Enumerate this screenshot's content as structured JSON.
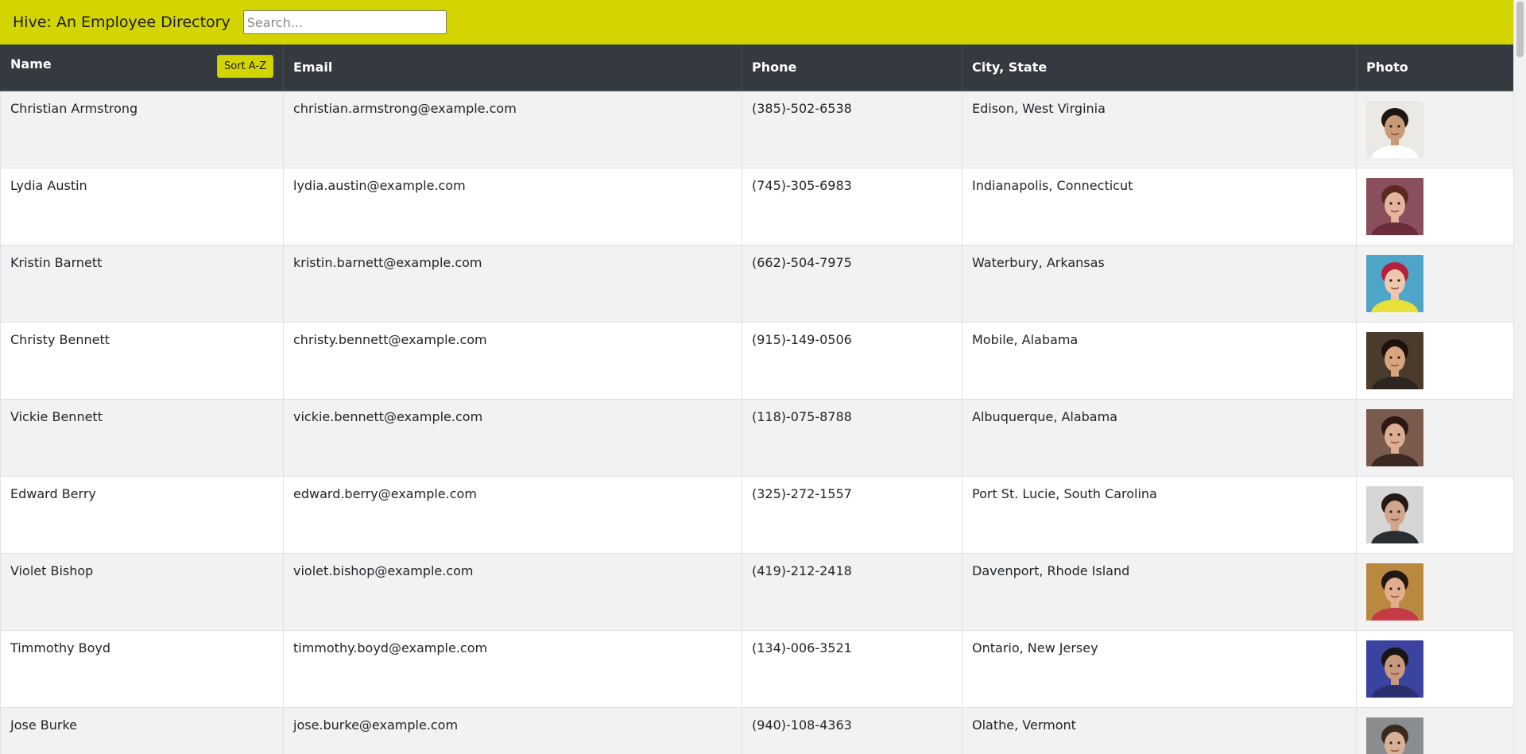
{
  "app": {
    "brand": "Hive: An Employee Directory",
    "search_placeholder": "Search...",
    "search_value": ""
  },
  "table": {
    "headers": {
      "name": "Name",
      "email": "Email",
      "phone": "Phone",
      "location": "City, State",
      "photo": "Photo"
    },
    "sort_label": "Sort A-Z",
    "rows": [
      {
        "name": "Christian Armstrong",
        "email": "christian.armstrong@example.com",
        "phone": "(385)-502-6538",
        "location": "Edison, West Virginia",
        "photo": {
          "skin": "#c99a78",
          "hair": "#1e1611",
          "bg": "#ebe9e4",
          "shirt": "#ffffff"
        }
      },
      {
        "name": "Lydia Austin",
        "email": "lydia.austin@example.com",
        "phone": "(745)-305-6983",
        "location": "Indianapolis, Connecticut",
        "photo": {
          "skin": "#e2b59c",
          "hair": "#5a2a20",
          "bg": "#8a4f5c",
          "shirt": "#6b2b3a"
        }
      },
      {
        "name": "Kristin Barnett",
        "email": "kristin.barnett@example.com",
        "phone": "(662)-504-7975",
        "location": "Waterbury, Arkansas",
        "photo": {
          "skin": "#f0c6ae",
          "hair": "#b3213a",
          "bg": "#4fa5c8",
          "shirt": "#e7e03a"
        }
      },
      {
        "name": "Christy Bennett",
        "email": "christy.bennett@example.com",
        "phone": "(915)-149-0506",
        "location": "Mobile, Alabama",
        "photo": {
          "skin": "#d9a47e",
          "hair": "#1c130e",
          "bg": "#4a3b2c",
          "shirt": "#2e2620"
        }
      },
      {
        "name": "Vickie Bennett",
        "email": "vickie.bennett@example.com",
        "phone": "(118)-075-8788",
        "location": "Albuquerque, Alabama",
        "photo": {
          "skin": "#dcae92",
          "hair": "#2b1812",
          "bg": "#7a5a4c",
          "shirt": "#3a2a22"
        }
      },
      {
        "name": "Edward Berry",
        "email": "edward.berry@example.com",
        "phone": "(325)-272-1557",
        "location": "Port St. Lucie, South Carolina",
        "photo": {
          "skin": "#d0a58c",
          "hair": "#231a16",
          "bg": "#d6d6d6",
          "shirt": "#2a2e33"
        }
      },
      {
        "name": "Violet Bishop",
        "email": "violet.bishop@example.com",
        "phone": "(419)-212-2418",
        "location": "Davenport, Rhode Island",
        "photo": {
          "skin": "#e3ad8e",
          "hair": "#211713",
          "bg": "#b8893e",
          "shirt": "#c43a45"
        }
      },
      {
        "name": "Timmothy Boyd",
        "email": "timmothy.boyd@example.com",
        "phone": "(134)-006-3521",
        "location": "Ontario, New Jersey",
        "photo": {
          "skin": "#c79a80",
          "hair": "#1a1410",
          "bg": "#3a44a0",
          "shirt": "#2a2f6e"
        }
      },
      {
        "name": "Jose Burke",
        "email": "jose.burke@example.com",
        "phone": "(940)-108-4363",
        "location": "Olathe, Vermont",
        "photo": {
          "skin": "#d8b096",
          "hair": "#3a2a1e",
          "bg": "#8a8d90",
          "shirt": "#4a4e52"
        }
      }
    ]
  },
  "colors": {
    "accent": "#d4d400",
    "header_bg": "#343a40",
    "row_odd": "#f2f2f2",
    "row_even": "#ffffff"
  }
}
